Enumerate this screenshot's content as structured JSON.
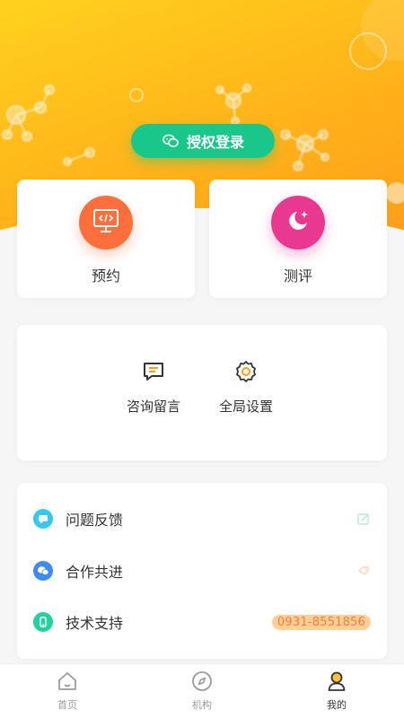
{
  "header": {
    "login_button": {
      "label": "授权登录",
      "icon": "wechat-icon",
      "color": "#19c78a"
    }
  },
  "quick_actions": [
    {
      "label": "预约",
      "icon": "monitor-code-icon",
      "color": "#ff6f3c"
    },
    {
      "label": "测评",
      "icon": "moon-star-icon",
      "color": "#e8388f"
    }
  ],
  "services": [
    {
      "label": "咨询留言",
      "icon": "message-icon"
    },
    {
      "label": "全局设置",
      "icon": "gear-icon"
    }
  ],
  "menu": [
    {
      "label": "问题反馈",
      "icon": "chat-bubble-icon",
      "color": "#37c8f0",
      "trailing_icon": "edit-icon"
    },
    {
      "label": "合作共进",
      "icon": "wechat-icon",
      "color": "#3d8af7",
      "trailing_icon": "tag-icon"
    },
    {
      "label": "技术支持",
      "icon": "phone-icon",
      "color": "#22d0a0",
      "trailing_text": "0931-8551856"
    }
  ],
  "tabbar": [
    {
      "label": "首页",
      "icon": "home-icon",
      "active": false
    },
    {
      "label": "机构",
      "icon": "compass-icon",
      "active": false
    },
    {
      "label": "我的",
      "icon": "user-icon",
      "active": true
    }
  ],
  "colors": {
    "header_start": "#ffd21f",
    "header_end": "#ff9d19",
    "phone_pill_bg": "#ffcf99",
    "phone_pill_text": "#ff7a2e"
  }
}
